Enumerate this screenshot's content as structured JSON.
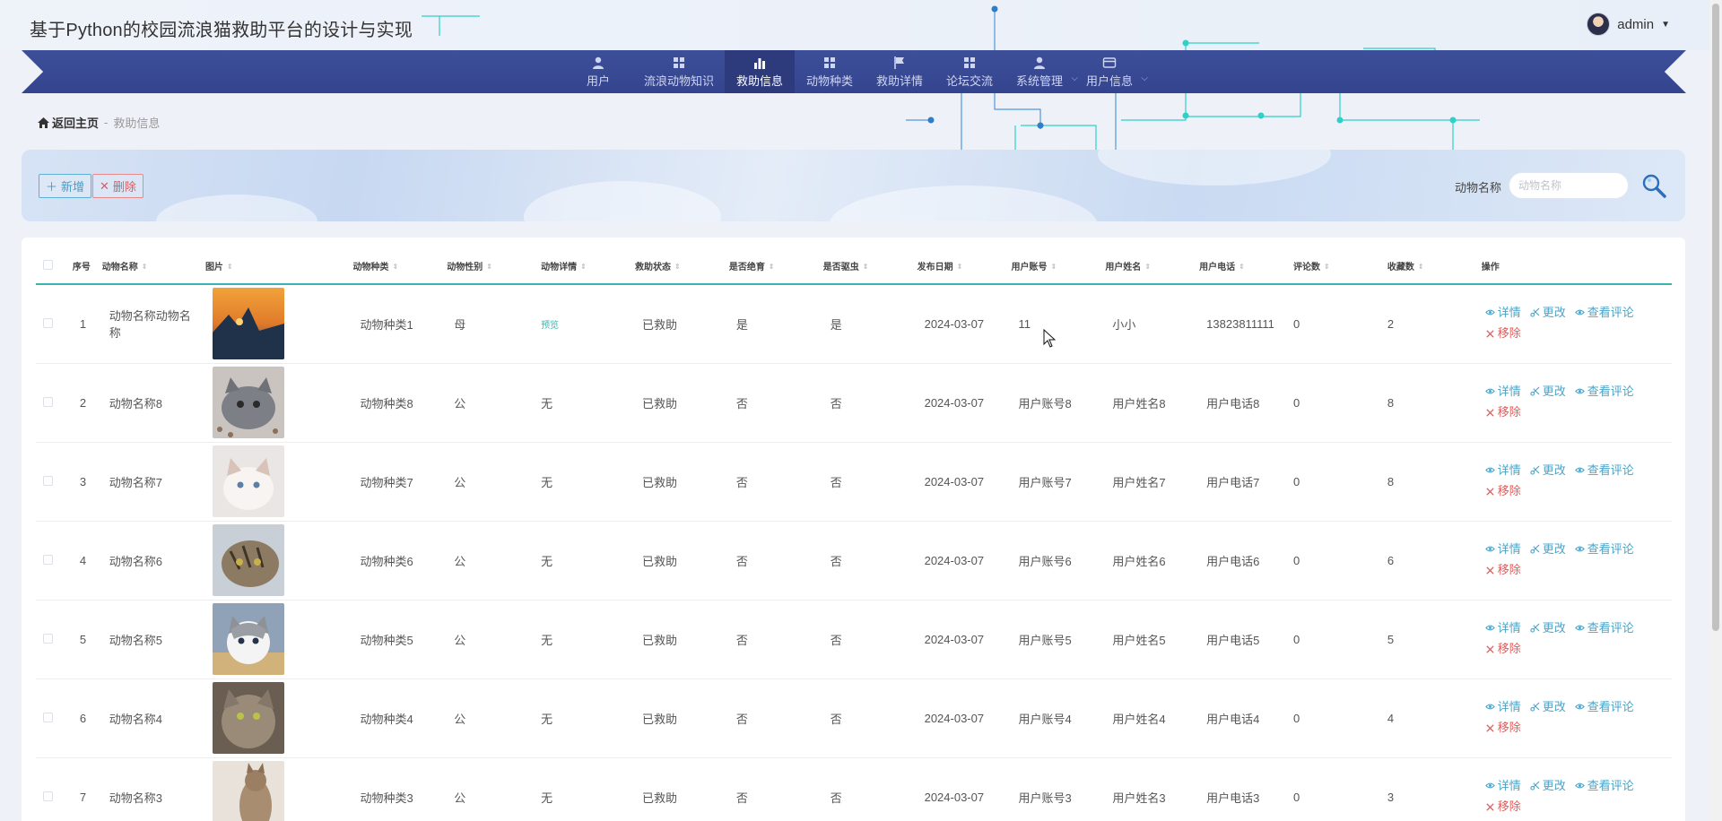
{
  "header": {
    "app_title": "基于Python的校园流浪猫救助平台的设计与实现",
    "username": "admin"
  },
  "nav": [
    {
      "label": "用户",
      "icon": "user-icon",
      "active": false
    },
    {
      "label": "流浪动物知识",
      "icon": "grid-icon",
      "active": false
    },
    {
      "label": "救助信息",
      "icon": "bar-chart-icon",
      "active": true
    },
    {
      "label": "动物种类",
      "icon": "grid-icon",
      "active": false
    },
    {
      "label": "救助详情",
      "icon": "flag-icon",
      "active": false
    },
    {
      "label": "论坛交流",
      "icon": "grid-icon",
      "active": false
    },
    {
      "label": "系统管理",
      "icon": "user-icon",
      "active": false,
      "dropdown": true
    },
    {
      "label": "用户信息",
      "icon": "card-icon",
      "active": false,
      "dropdown": true
    }
  ],
  "breadcrumb": {
    "home": "返回主页",
    "separator": "-",
    "current": "救助信息"
  },
  "toolbar": {
    "add_label": "新增",
    "delete_label": "删除",
    "search_label": "动物名称",
    "search_placeholder": "动物名称",
    "search_value": ""
  },
  "table": {
    "columns": [
      "序号",
      "动物名称",
      "图片",
      "动物种类",
      "动物性别",
      "动物详情",
      "救助状态",
      "是否绝育",
      "是否驱虫",
      "发布日期",
      "用户账号",
      "用户姓名",
      "用户电话",
      "评论数",
      "收藏数",
      "操作"
    ],
    "actions": {
      "detail": "详情",
      "edit": "更改",
      "comments": "查看评论",
      "remove": "移除"
    },
    "rows": [
      {
        "no": "1",
        "name": "动物名称动物名称",
        "photo": "sunset-coast",
        "species": "动物种类1",
        "gender": "母",
        "detail": "预览",
        "status": "已救助",
        "neutered": "是",
        "dewormed": "是",
        "date": "2024-03-07",
        "account": "11",
        "username": "小小",
        "phone": "13823811111",
        "comments": "0",
        "favorites": "2"
      },
      {
        "no": "2",
        "name": "动物名称8",
        "photo": "grey-cat",
        "species": "动物种类8",
        "gender": "公",
        "detail": "无",
        "status": "已救助",
        "neutered": "否",
        "dewormed": "否",
        "date": "2024-03-07",
        "account": "用户账号8",
        "username": "用户姓名8",
        "phone": "用户电话8",
        "comments": "0",
        "favorites": "8"
      },
      {
        "no": "3",
        "name": "动物名称7",
        "photo": "white-kitten",
        "species": "动物种类7",
        "gender": "公",
        "detail": "无",
        "status": "已救助",
        "neutered": "否",
        "dewormed": "否",
        "date": "2024-03-07",
        "account": "用户账号7",
        "username": "用户姓名7",
        "phone": "用户电话7",
        "comments": "0",
        "favorites": "8"
      },
      {
        "no": "4",
        "name": "动物名称6",
        "photo": "tabby-cat",
        "species": "动物种类6",
        "gender": "公",
        "detail": "无",
        "status": "已救助",
        "neutered": "否",
        "dewormed": "否",
        "date": "2024-03-07",
        "account": "用户账号6",
        "username": "用户姓名6",
        "phone": "用户电话6",
        "comments": "0",
        "favorites": "6"
      },
      {
        "no": "5",
        "name": "动物名称5",
        "photo": "grey-white-kitten",
        "species": "动物种类5",
        "gender": "公",
        "detail": "无",
        "status": "已救助",
        "neutered": "否",
        "dewormed": "否",
        "date": "2024-03-07",
        "account": "用户账号5",
        "username": "用户姓名5",
        "phone": "用户电话5",
        "comments": "0",
        "favorites": "5"
      },
      {
        "no": "6",
        "name": "动物名称4",
        "photo": "long-hair-cat",
        "species": "动物种类4",
        "gender": "公",
        "detail": "无",
        "status": "已救助",
        "neutered": "否",
        "dewormed": "否",
        "date": "2024-03-07",
        "account": "用户账号4",
        "username": "用户姓名4",
        "phone": "用户电话4",
        "comments": "0",
        "favorites": "4"
      },
      {
        "no": "7",
        "name": "动物名称3",
        "photo": "sitting-cat",
        "species": "动物种类3",
        "gender": "公",
        "detail": "无",
        "status": "已救助",
        "neutered": "否",
        "dewormed": "否",
        "date": "2024-03-07",
        "account": "用户账号3",
        "username": "用户姓名3",
        "phone": "用户电话3",
        "comments": "0",
        "favorites": "3"
      }
    ]
  },
  "colors": {
    "nav": "#3e4f9a",
    "nav_active": "#2d3a7c",
    "accent": "#3bb3ae",
    "link": "#4aa4c8",
    "danger": "#e05a5a"
  }
}
